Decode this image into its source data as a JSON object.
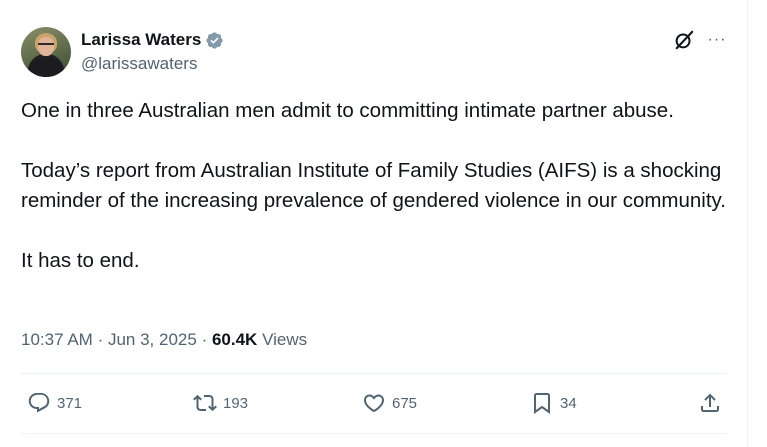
{
  "author": {
    "display_name": "Larissa Waters",
    "handle": "@larissawaters",
    "verified": true
  },
  "icons": {
    "verified": "verified-badge-icon",
    "grok": "grok-icon",
    "more": "more-icon",
    "reply": "reply-icon",
    "repost": "repost-icon",
    "like": "like-icon",
    "bookmark": "bookmark-icon",
    "share": "share-icon"
  },
  "tweet": {
    "paragraphs": [
      "One in three Australian men admit to committing intimate partner abuse.",
      "Today’s report from Australian Institute of Family Studies (AIFS) is a shocking reminder of the increasing prevalence of gendered violence in our community.",
      "It has to end."
    ]
  },
  "meta": {
    "time": "10:37 AM",
    "separator": "·",
    "date": "Jun 3, 2025",
    "views_count": "60.4K",
    "views_label": "Views"
  },
  "actions": {
    "replies": "371",
    "reposts": "193",
    "likes": "675",
    "bookmarks": "34"
  },
  "colors": {
    "text": "#0f1419",
    "secondary": "#536471",
    "verified": "#829aab",
    "divider": "#eff3f4"
  },
  "more_glyph": "···"
}
